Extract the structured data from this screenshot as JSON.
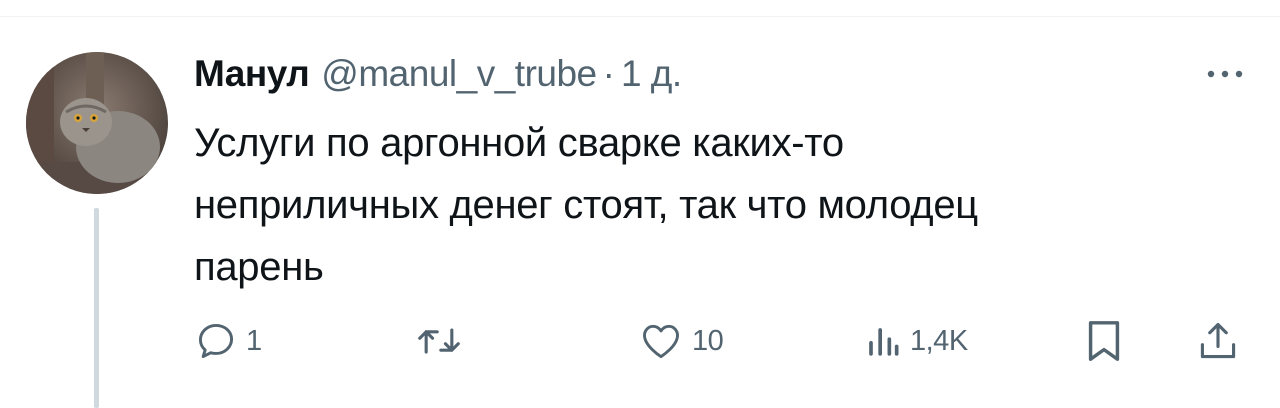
{
  "tweet": {
    "author_name": "Манул",
    "handle": "@manul_v_trube",
    "separator": "·",
    "time": "1 д.",
    "text": "Услуги по аргонной сварке каких-то\nнеприличных денег стоят, так что молодец\nпарень"
  },
  "actions": {
    "reply": {
      "icon": "reply-icon",
      "count": "1"
    },
    "retweet": {
      "icon": "retweet-icon",
      "count": ""
    },
    "like": {
      "icon": "heart-icon",
      "count": "10"
    },
    "views": {
      "icon": "views-icon",
      "count": "1,4K"
    },
    "bookmark": {
      "icon": "bookmark-icon"
    },
    "share": {
      "icon": "share-icon"
    }
  },
  "colors": {
    "text": "#0f1419",
    "secondary": "#536471",
    "thread_line": "#cfd9de",
    "divider": "#eff3f4"
  }
}
